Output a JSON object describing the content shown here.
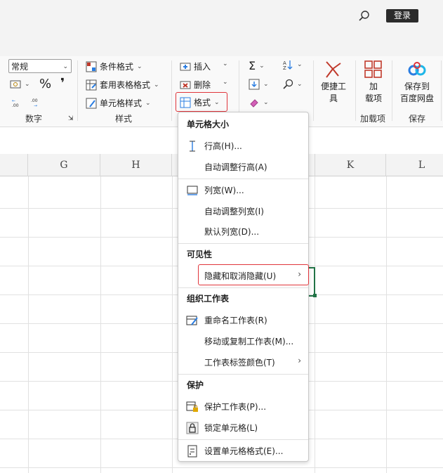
{
  "header": {
    "login_label": "登录"
  },
  "ribbon": {
    "number": {
      "format_select": "常规",
      "percent_symbol": "%",
      "comma_symbol": "❜",
      "group_label": "数字"
    },
    "styles": {
      "conditional_format": "条件格式",
      "table_format": "套用表格格式",
      "cell_style": "单元格样式",
      "group_label": "样式"
    },
    "cells": {
      "insert": "插入",
      "delete": "删除",
      "format": "格式"
    },
    "convenience": {
      "label_line1": "便捷工",
      "label_line2": "具"
    },
    "addins": {
      "label_line1": "加",
      "label_line2": "载项",
      "group_label": "加载项"
    },
    "save": {
      "label_line1": "保存到",
      "label_line2": "百度网盘",
      "group_label": "保存"
    }
  },
  "columns": [
    "G",
    "H",
    "K",
    "L"
  ],
  "menu": {
    "section_size": "单元格大小",
    "row_height": "行高(H)...",
    "autofit_row": "自动调整行高(A)",
    "col_width": "列宽(W)...",
    "autofit_col": "自动调整列宽(I)",
    "default_width": "默认列宽(D)...",
    "section_visibility": "可见性",
    "hide_unhide": "隐藏和取消隐藏(U)",
    "section_organize": "组织工作表",
    "rename_sheet": "重命名工作表(R)",
    "move_copy_sheet": "移动或复制工作表(M)...",
    "tab_color": "工作表标签颜色(T)",
    "section_protect": "保护",
    "protect_sheet": "保护工作表(P)...",
    "lock_cell": "锁定单元格(L)",
    "format_cells": "设置单元格格式(E)..."
  },
  "colors": {
    "highlight": "#e0353b",
    "excel_green": "#217346",
    "accent_red": "#c0392b",
    "baidu_blue": "#2a7de1"
  }
}
